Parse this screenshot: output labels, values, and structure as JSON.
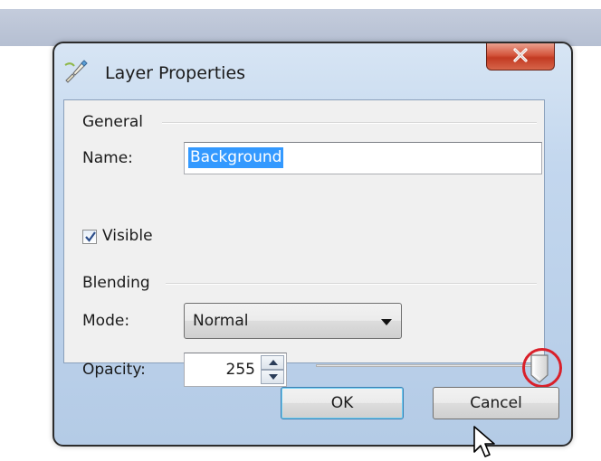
{
  "window": {
    "title": "Layer Properties",
    "close_glyph": "X",
    "icon": "paintbrush-icon"
  },
  "general": {
    "group_label": "General",
    "name_label": "Name:",
    "name_value": "Background",
    "visible_label": "Visible",
    "visible_checked": true
  },
  "blending": {
    "group_label": "Blending",
    "mode_label": "Mode:",
    "mode_value": "Normal",
    "opacity_label": "Opacity:",
    "opacity_value": "255",
    "opacity_slider_fraction": 1.0
  },
  "buttons": {
    "ok": "OK",
    "cancel": "Cancel"
  },
  "colors": {
    "close_button": "#c94a32",
    "highlight_circle": "#d9202a",
    "selection": "#3399ff"
  }
}
